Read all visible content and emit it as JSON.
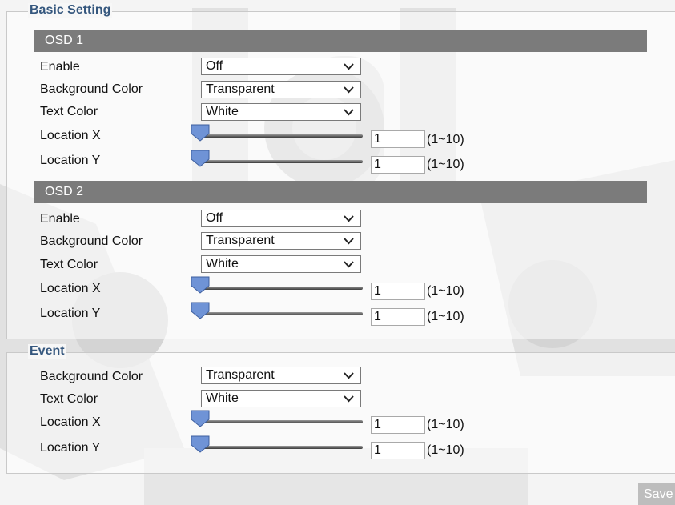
{
  "sections": {
    "basic_setting": {
      "title": "Basic Setting",
      "osd1": {
        "header": "OSD 1",
        "enable": {
          "label": "Enable",
          "value": "Off"
        },
        "background_color": {
          "label": "Background Color",
          "value": "Transparent"
        },
        "text_color": {
          "label": "Text Color",
          "value": "White"
        },
        "location_x": {
          "label": "Location X",
          "value": "1",
          "range": "(1~10)"
        },
        "location_y": {
          "label": "Location Y",
          "value": "1",
          "range": "(1~10)"
        }
      },
      "osd2": {
        "header": "OSD 2",
        "enable": {
          "label": "Enable",
          "value": "Off"
        },
        "background_color": {
          "label": "Background Color",
          "value": "Transparent"
        },
        "text_color": {
          "label": "Text Color",
          "value": "White"
        },
        "location_x": {
          "label": "Location X",
          "value": "1",
          "range": "(1~10)"
        },
        "location_y": {
          "label": "Location Y",
          "value": "1",
          "range": "(1~10)"
        }
      }
    },
    "event": {
      "title": "Event",
      "background_color": {
        "label": "Background Color",
        "value": "Transparent"
      },
      "text_color": {
        "label": "Text Color",
        "value": "White"
      },
      "location_x": {
        "label": "Location X",
        "value": "1",
        "range": "(1~10)"
      },
      "location_y": {
        "label": "Location Y",
        "value": "1",
        "range": "(1~10)"
      }
    }
  },
  "actions": {
    "save_label": "Save"
  },
  "colors": {
    "section_title": "#35577e",
    "header_bar": "#7b7b7b",
    "slider_thumb": "#6f93d6"
  },
  "icons": {
    "dropdown": "chevron-down-icon",
    "slider_thumb": "slider-thumb-icon"
  }
}
